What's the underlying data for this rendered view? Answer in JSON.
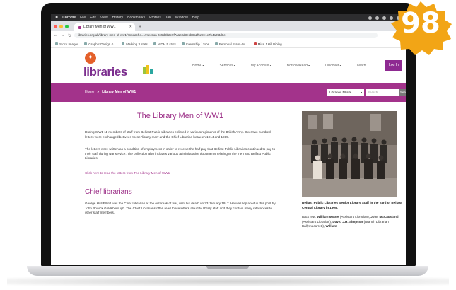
{
  "badge": {
    "number": "98",
    "color": "#f2a516"
  },
  "menubar": {
    "items": [
      "Chrome",
      "File",
      "Edit",
      "View",
      "History",
      "Bookmarks",
      "Profiles",
      "Tab",
      "Window",
      "Help"
    ]
  },
  "browser": {
    "tab_title": "Library Men of WW1",
    "url": "libraries.org.uk/library-men-of-ww1/?nocache=1#section-4c5d8b2e9f7a1c0d3e6b8a2f5d9e1c7b4a0f3d6e",
    "bookmarks": [
      "Stock Images",
      "Graphic Design &...",
      "Marking 3 stats",
      "NIDM 5 stats",
      "Internship / Jobs",
      "Personal Stats - M...",
      "Miss J Hill Biblog..."
    ]
  },
  "site": {
    "logo_text": "libraries",
    "nav": [
      "Home",
      "Services",
      "My Account",
      "Borrow/Read",
      "Discover",
      "Learn"
    ],
    "login": "Log In",
    "breadcrumb_home": "Home",
    "breadcrumb_sep": "»",
    "breadcrumb_current": "Library Men of WW1",
    "site_select": "Libraries NI site",
    "search_placeholder": "Search...",
    "search_button": "Search"
  },
  "article": {
    "title": "The Library Men of WW1",
    "para1": "During WW1 11 members of staff from Belfast Public Libraries enlisted in various regiments of the British Army. Over two hundred letters were exchanged between these 'library men' and the Chief Librarian between 1914 and 1919.",
    "para2": "The letters were written as a condition of employment in order to receive the half-pay that Belfast Public Libraries continued to pay to their staff during war service. The collection also includes various administrative documents relating to the men and Belfast Public Libraries.",
    "link": "Click here to read the letters from The Library Men of WW1",
    "section_title": "Chief librarians",
    "para3": "George Hall Elliott was the Chief Librarian at the outbreak of war, until his death on 23 January 1917. He was replaced in this post by John Bowick Goldsborough. The Chief Librarians often read these letters aloud to library staff and they contain many references to other staff members."
  },
  "photo": {
    "caption": "Belfast Public Libraries Senior Library Staff in the yard of Belfast Central Library in 1905.",
    "back_row_prefix": "Back row: ",
    "name1": "William Moore",
    "role1": " (Assistant Librarian), ",
    "name2": "John McCausland",
    "role2": " (Assistant Librarian), ",
    "name3": "David J.H. Simpson",
    "role3": " (Branch Librarian Ballymacarrett), ",
    "name4": "William"
  }
}
